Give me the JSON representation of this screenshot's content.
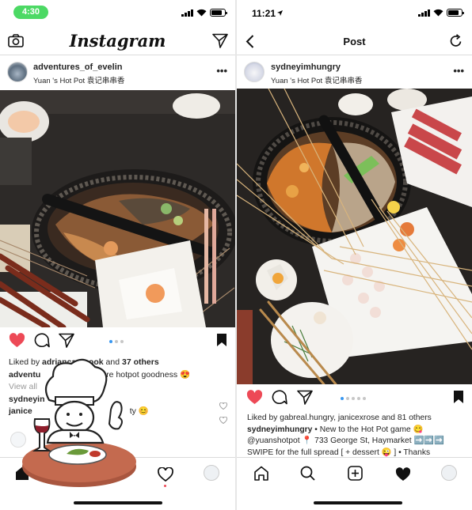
{
  "left": {
    "status_time": "4:30",
    "app_logo": "Instagram",
    "post": {
      "username": "adventures_of_evelin",
      "location": "Yuan 's Hot Pot 袁记串串香",
      "likes_prefix": "Liked by ",
      "likes_user": "adriancantcook",
      "likes_mid": " and ",
      "likes_count": "37 others",
      "caption_user": "adventu",
      "caption_text": "re hotpot goodness 😍",
      "view_all": "View all",
      "comment1_user": "sydneyin",
      "comment2_user": "janice",
      "comment2_text": "ty 😊"
    }
  },
  "right": {
    "status_time": "11:21",
    "nav_title": "Post",
    "post": {
      "username": "sydneyimhungry",
      "location": "Yuan 's Hot Pot 袁记串串香",
      "likes_prefix": "Liked by ",
      "likes_user": "gabreal.hungry, janicexrose",
      "likes_mid": " and ",
      "likes_count": "81 others",
      "caption_user": "sydneyimhungry",
      "caption_line1": " • New to the Hot Pot game 😋",
      "caption_line2": "@yuanshotpot 📍 733 George St, Haymarket ➡️➡️➡️",
      "caption_line3": "SWIPE for the full spread [ + dessert 😜 ] • Thanks"
    }
  },
  "colors": {
    "like_red": "#ed4956",
    "link_blue": "#3897f0",
    "status_green": "#4cd964"
  },
  "icons": [
    "camera-icon",
    "send-icon",
    "back-icon",
    "refresh-icon",
    "heart-icon",
    "comment-icon",
    "bookmark-icon",
    "home-icon",
    "search-icon",
    "add-icon",
    "activity-icon",
    "profile-icon",
    "more-icon",
    "chef-icon"
  ]
}
